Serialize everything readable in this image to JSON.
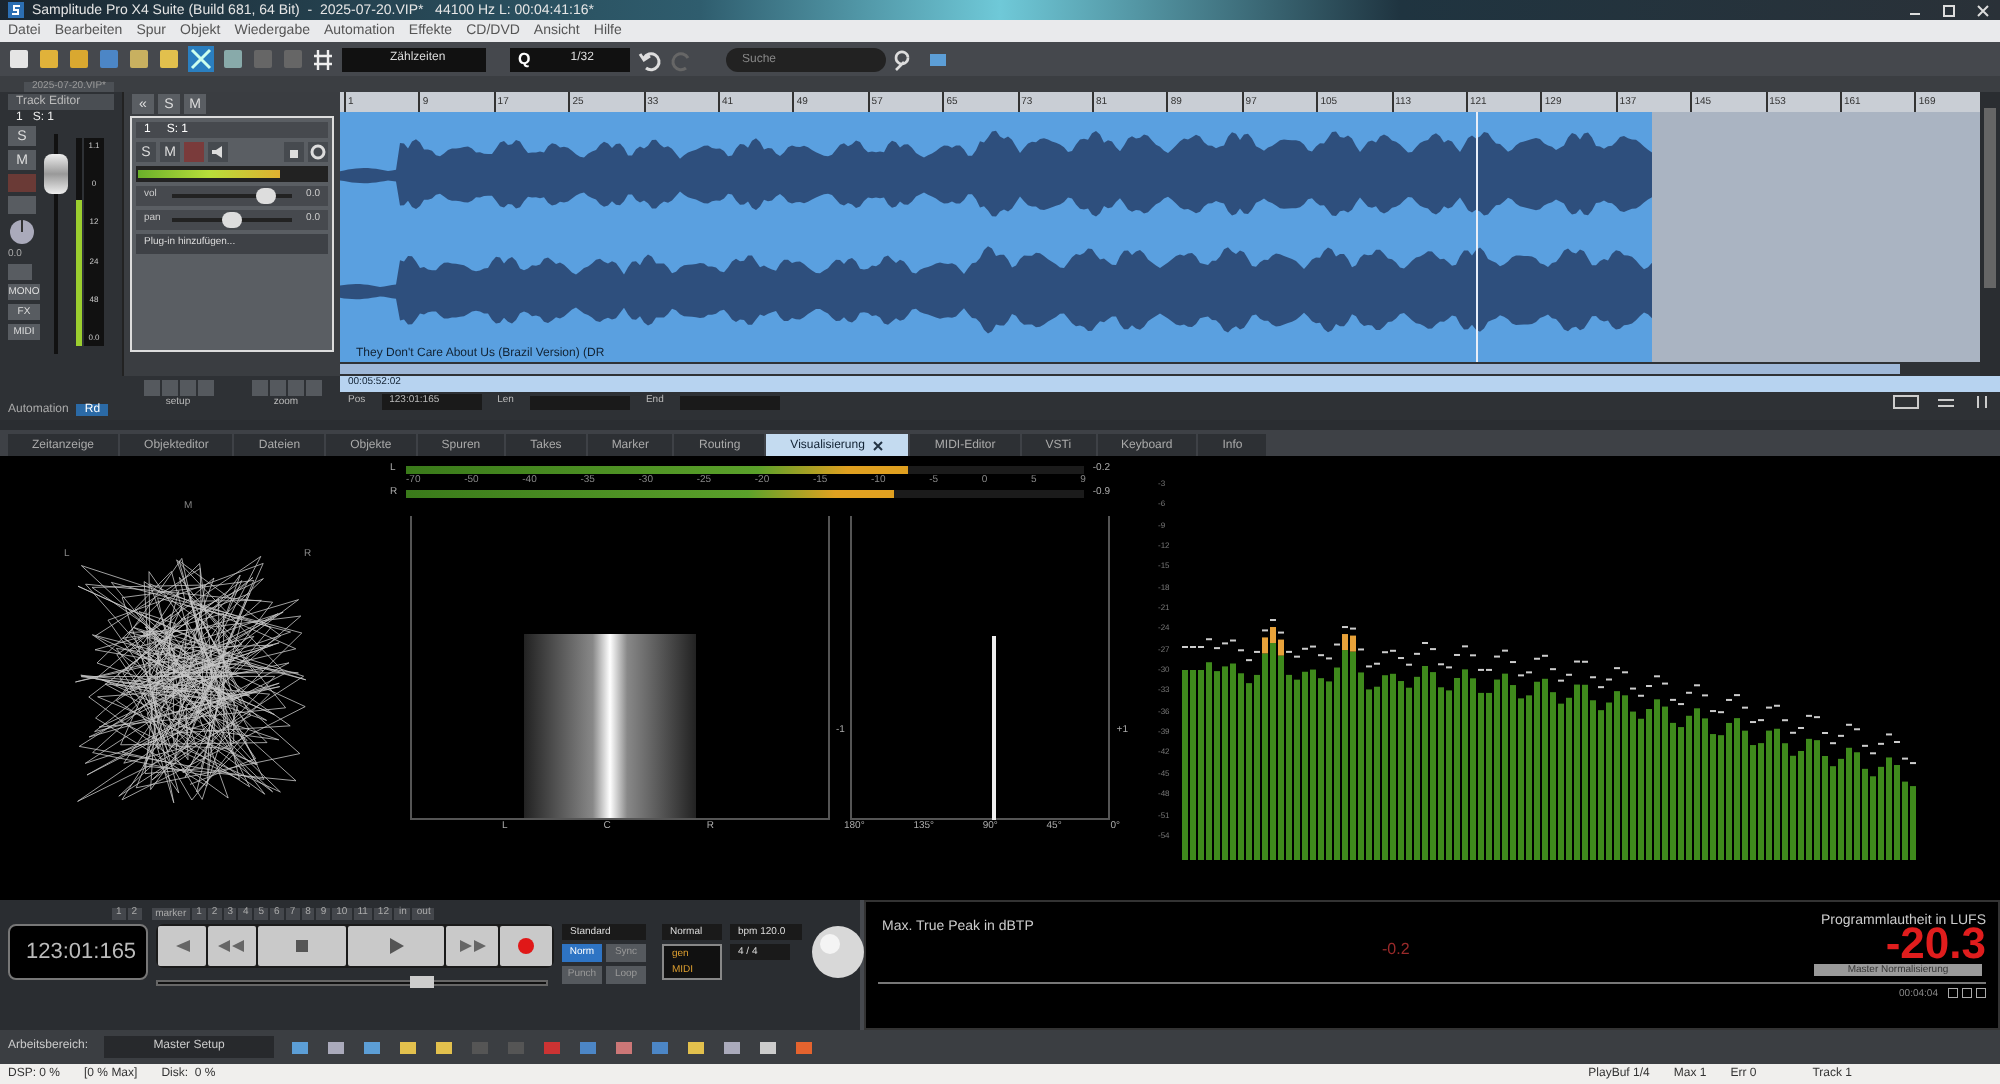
{
  "window": {
    "title": "Samplitude Pro X4 Suite (Build 681, 64 Bit)  -  2025-07-20.VIP*   44100 Hz L: 00:04:41:16*"
  },
  "menu": [
    "Datei",
    "Bearbeiten",
    "Spur",
    "Objekt",
    "Wiedergabe",
    "Automation",
    "Effekte",
    "CD/DVD",
    "Ansicht",
    "Hilfe"
  ],
  "toolbar": {
    "grid_mode": "Zählzeiten",
    "quantize_label": "Q",
    "quantize": "1/32",
    "search": {
      "placeholder": "Suche"
    }
  },
  "project_tab": "2025-07-20.VIP*",
  "track_editor": {
    "title": "Track Editor",
    "track": "1   S: 1",
    "solo": "S",
    "mute": "M",
    "meter_scale": [
      "1.1",
      "0",
      "12",
      "24",
      "48"
    ],
    "knob_reading": "0.0",
    "meter_reading": "0.0",
    "mono": "MONO",
    "fx": "FX",
    "midi": "MIDI",
    "automation": "Automation",
    "automation_mode": "Rd"
  },
  "arrange_buttons": {
    "collapse": "«",
    "solo": "S",
    "mute": "M"
  },
  "track": {
    "number": "1",
    "name": "S: 1",
    "solo_label": "S",
    "mute_label": "M",
    "record": false,
    "volume": {
      "label": "vol",
      "level": 0.78,
      "reading": "0.0"
    },
    "pan": {
      "label": "pan",
      "level": 0.5,
      "reading": "0.0"
    },
    "plugin": "Plug-in hinzufügen..."
  },
  "nav": {
    "setup": "setup",
    "zoom": "zoom"
  },
  "ruler": [
    "1",
    "9",
    "17",
    "25",
    "33",
    "41",
    "49",
    "57",
    "65",
    "73",
    "81",
    "89",
    "97",
    "105",
    "113",
    "121",
    "129",
    "137",
    "145",
    "153",
    "161",
    "169"
  ],
  "clip": {
    "name": "They Don't Care About Us (Brazil Version) (DR"
  },
  "position": {
    "time": "00:05:52:02",
    "pos_label": "Pos",
    "pos": "123:01:165",
    "len_label": "Len",
    "end_label": "End"
  },
  "tabs": [
    {
      "label": "Zeitanzeige",
      "selected": false
    },
    {
      "label": "Objekteditor",
      "selected": false
    },
    {
      "label": "Dateien",
      "selected": false
    },
    {
      "label": "Objekte",
      "selected": false
    },
    {
      "label": "Spuren",
      "selected": false
    },
    {
      "label": "Takes",
      "selected": false
    },
    {
      "label": "Marker",
      "selected": false
    },
    {
      "label": "Routing",
      "selected": false
    },
    {
      "label": "Visualisierung",
      "selected": true
    },
    {
      "label": "MIDI-Editor",
      "selected": false
    },
    {
      "label": "VSTi",
      "selected": false
    },
    {
      "label": "Keyboard",
      "selected": false
    },
    {
      "label": "Info",
      "selected": false
    }
  ],
  "goniometer": {
    "top": "M",
    "left": "L",
    "right": "R"
  },
  "level_meter": {
    "channels": [
      {
        "name": "L",
        "level": 0.74,
        "reading": "-0.2"
      },
      {
        "name": "R",
        "level": 0.72,
        "reading": "-0.9"
      }
    ],
    "scale": [
      "-70",
      "-50",
      "-40",
      "-35",
      "-30",
      "-25",
      "-20",
      "-15",
      "-10",
      "-5",
      "0",
      "5",
      "9"
    ]
  },
  "stereo_image": {
    "labels": [
      "L",
      "C",
      "R"
    ]
  },
  "phase": {
    "minus": "-1",
    "plus": "+1",
    "labels": [
      "180°",
      "135°",
      "90°",
      "45°",
      "0°"
    ]
  },
  "spectrum": {
    "scale": [
      "-3",
      "-6",
      "-9",
      "-12",
      "-15",
      "-18",
      "-21",
      "-24",
      "-27",
      "-30",
      "-33",
      "-36",
      "-39",
      "-42",
      "-45",
      "-48",
      "-51",
      "-54"
    ]
  },
  "transport": {
    "time": "123:01:165",
    "marker_pre": [
      "1",
      "2"
    ],
    "marker_label": "marker",
    "markers": [
      "1",
      "2",
      "3",
      "4",
      "5",
      "6",
      "7",
      "8",
      "9",
      "10",
      "11",
      "12"
    ],
    "marker_post": [
      "in",
      "out"
    ],
    "mode": "Standard",
    "norm": {
      "label": "Norm",
      "on": true
    },
    "sync": {
      "label": "Sync",
      "on": false
    },
    "punch": {
      "label": "Punch",
      "on": false
    },
    "loop": {
      "label": "Loop",
      "on": false
    },
    "play_mode": "Normal",
    "bpm": "bpm 120.0",
    "meter": "4 / 4",
    "sync_gen": "gen",
    "sync_midi": "MIDI",
    "scrub": {
      "level": 0.68
    }
  },
  "workspace": {
    "label": "Arbeitsbereich:",
    "value": "Master Setup"
  },
  "loudness": {
    "peak_title": "Max. True Peak in dBTP",
    "peak": "-0.2",
    "loudness_title": "Programmlautheit in LUFS",
    "loudness": "-20.3",
    "normalize": "Master Normalisierung",
    "time": "00:04:04"
  },
  "status_bar": {
    "dsp": "DSP: 0 %",
    "dsp_max": "[0 % Max]",
    "disk": "Disk:  0 %",
    "playbuf": "PlayBuf 1/4",
    "max": "Max 1",
    "err": "Err 0",
    "track": "Track 1"
  }
}
